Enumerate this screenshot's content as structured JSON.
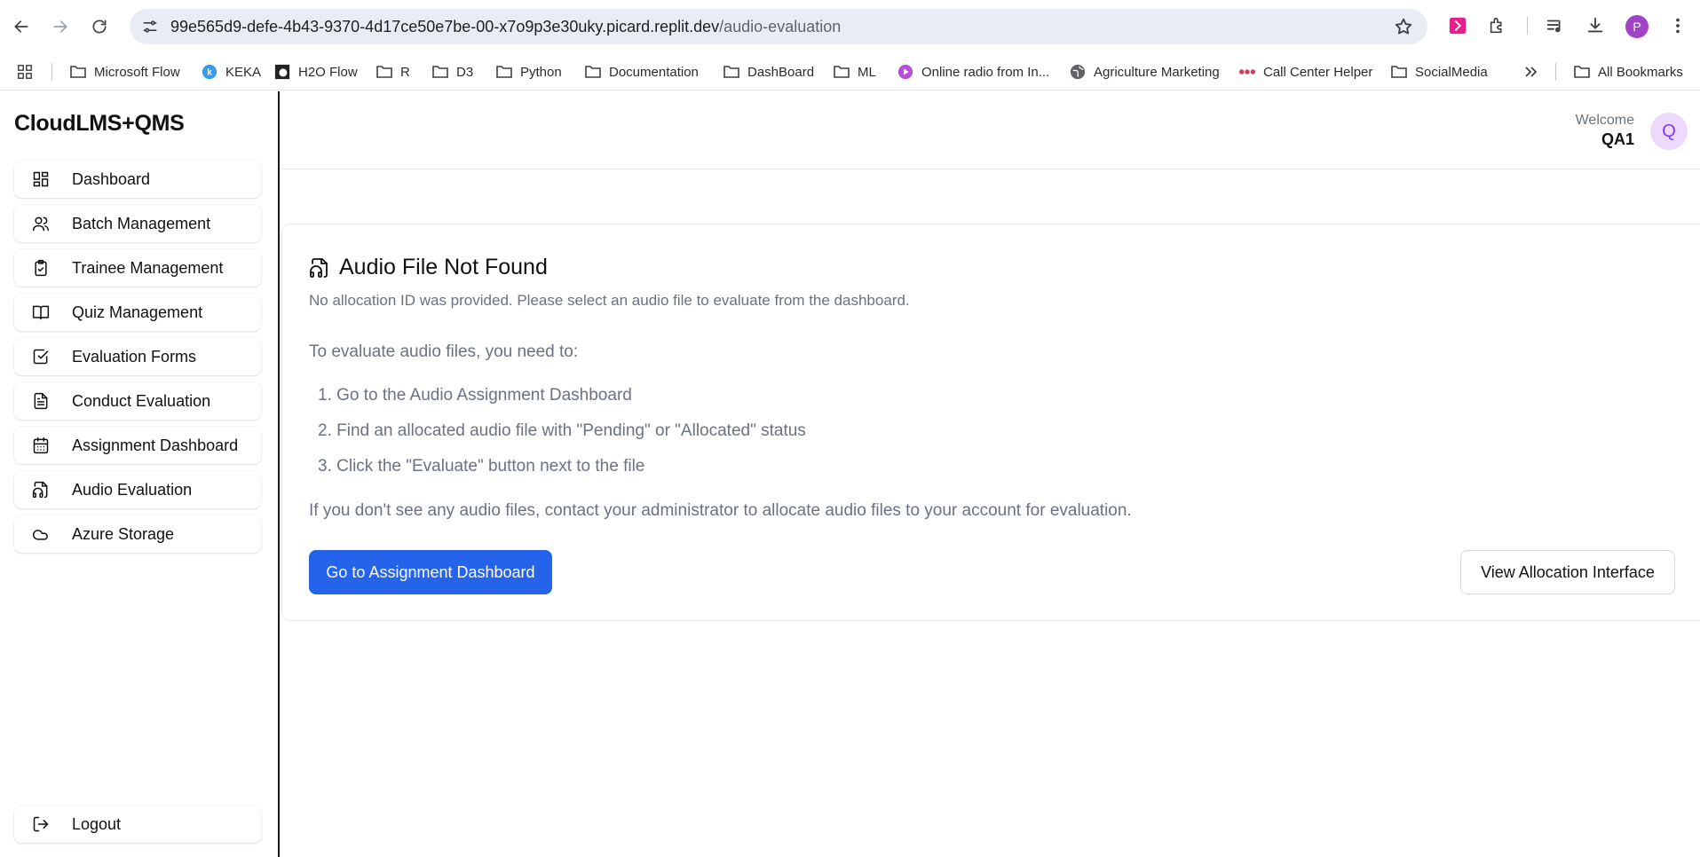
{
  "browser": {
    "url_host": "99e565d9-defe-4b43-9370-4d17ce50e7be-00-x7o9p3e30uky.picard.replit.dev",
    "url_path": "/audio-evaluation",
    "profile_initial": "P",
    "bookmarks": [
      {
        "label": "Microsoft Flow",
        "icon": "folder-icon"
      },
      {
        "label": "KEKA",
        "icon": "keka-icon"
      },
      {
        "label": "H2O Flow",
        "icon": "h2o-icon"
      },
      {
        "label": "R",
        "icon": "folder-icon"
      },
      {
        "label": "D3",
        "icon": "folder-icon"
      },
      {
        "label": "Python",
        "icon": "folder-icon"
      },
      {
        "label": "Documentation",
        "icon": "folder-icon"
      },
      {
        "label": "DashBoard",
        "icon": "folder-icon"
      },
      {
        "label": "ML",
        "icon": "folder-icon"
      },
      {
        "label": "Online radio from In...",
        "icon": "radio-icon"
      },
      {
        "label": "Agriculture Marketing",
        "icon": "globe-icon"
      },
      {
        "label": "Call Center Helper",
        "icon": "dots-icon"
      },
      {
        "label": "SocialMedia",
        "icon": "folder-icon"
      }
    ],
    "all_bookmarks": "All Bookmarks"
  },
  "app": {
    "brand": "CloudLMS+QMS",
    "nav": [
      {
        "label": "Dashboard",
        "icon": "dashboard-icon"
      },
      {
        "label": "Batch Management",
        "icon": "users-icon"
      },
      {
        "label": "Trainee Management",
        "icon": "clipboard-check-icon"
      },
      {
        "label": "Quiz Management",
        "icon": "book-open-icon"
      },
      {
        "label": "Evaluation Forms",
        "icon": "check-square-icon"
      },
      {
        "label": "Conduct Evaluation",
        "icon": "file-text-icon"
      },
      {
        "label": "Assignment Dashboard",
        "icon": "calendar-icon"
      },
      {
        "label": "Audio Evaluation",
        "icon": "file-audio-icon"
      },
      {
        "label": "Azure Storage",
        "icon": "cloud-icon"
      }
    ],
    "logout": "Logout"
  },
  "header": {
    "welcome": "Welcome",
    "username": "QA1",
    "avatar_initial": "Q"
  },
  "card": {
    "title": "Audio File Not Found",
    "description": "No allocation ID was provided. Please select an audio file to evaluate from the dashboard.",
    "intro": "To evaluate audio files, you need to:",
    "steps": [
      "1. Go to the Audio Assignment Dashboard",
      "2. Find an allocated audio file with \"Pending\" or \"Allocated\" status",
      "3. Click the \"Evaluate\" button next to the file"
    ],
    "note": "If you don't see any audio files, contact your administrator to allocate audio files to your account for evaluation.",
    "primary_button": "Go to Assignment Dashboard",
    "secondary_button": "View Allocation Interface"
  },
  "colors": {
    "primary": "#2563eb",
    "avatar_bg": "#ecd9fb",
    "muted_text": "#6b7280"
  }
}
